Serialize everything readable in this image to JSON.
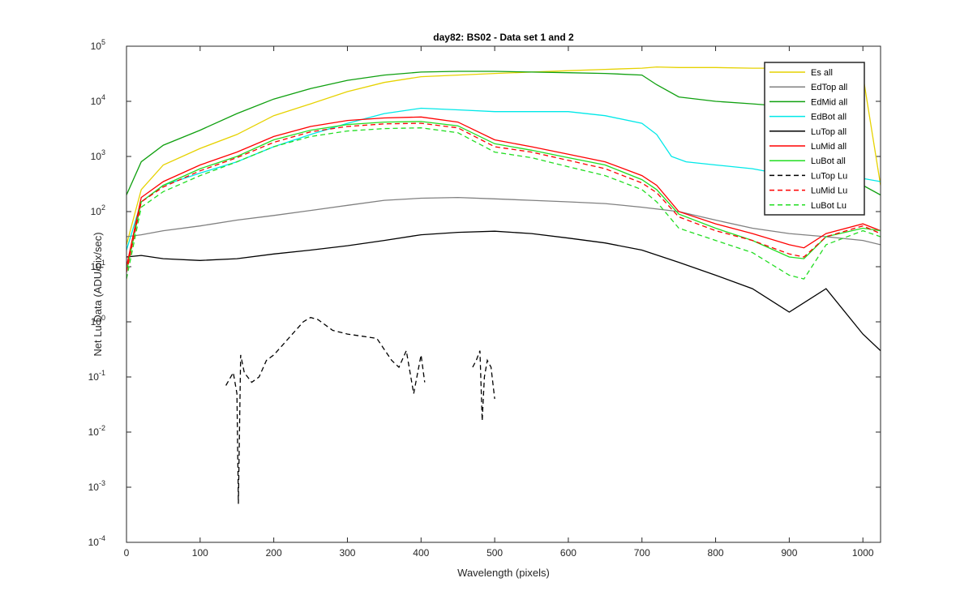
{
  "chart_data": {
    "type": "line",
    "title": "day82: BS02 - Data set 1 and 2",
    "xlabel": "Wavelength (pixels)",
    "ylabel": "Net Lu Data (ADU/pix/sec)",
    "xlim": [
      0,
      1024
    ],
    "ylim": [
      0.0001,
      100000
    ],
    "yscale": "log",
    "grid": false,
    "legend_position": "top-right",
    "x_ticks": [
      "0",
      "100",
      "200",
      "300",
      "400",
      "500",
      "600",
      "700",
      "800",
      "900",
      "1000"
    ],
    "y_ticks": [
      {
        "base": "10",
        "exp": "-4"
      },
      {
        "base": "10",
        "exp": "-3"
      },
      {
        "base": "10",
        "exp": "-2"
      },
      {
        "base": "10",
        "exp": "-1"
      },
      {
        "base": "10",
        "exp": "0"
      },
      {
        "base": "10",
        "exp": "1"
      },
      {
        "base": "10",
        "exp": "2"
      },
      {
        "base": "10",
        "exp": "3"
      },
      {
        "base": "10",
        "exp": "4"
      },
      {
        "base": "10",
        "exp": "5"
      }
    ],
    "series": [
      {
        "name": "Es  all",
        "color": "#e6d200",
        "dash": "solid",
        "x": [
          0,
          20,
          50,
          100,
          150,
          200,
          250,
          300,
          350,
          400,
          450,
          500,
          550,
          600,
          650,
          700,
          720,
          750,
          800,
          850,
          900,
          950,
          1000,
          1024
        ],
        "y": [
          25,
          250,
          700,
          1400,
          2500,
          5500,
          9000,
          15000,
          22000,
          28000,
          30000,
          32000,
          34000,
          36000,
          38000,
          40000,
          42000,
          41000,
          41000,
          40000,
          40000,
          39000,
          30000,
          300
        ]
      },
      {
        "name": "EdTop  all",
        "color": "#808080",
        "dash": "solid",
        "x": [
          0,
          20,
          50,
          100,
          150,
          200,
          250,
          300,
          350,
          400,
          450,
          500,
          550,
          600,
          650,
          700,
          750,
          800,
          850,
          900,
          950,
          1000,
          1024
        ],
        "y": [
          35,
          38,
          45,
          55,
          70,
          85,
          105,
          130,
          160,
          175,
          180,
          170,
          160,
          150,
          140,
          120,
          100,
          70,
          50,
          40,
          35,
          30,
          25
        ]
      },
      {
        "name": "EdMid  all",
        "color": "#0fa00f",
        "dash": "solid",
        "x": [
          0,
          20,
          50,
          100,
          150,
          200,
          250,
          300,
          350,
          400,
          450,
          500,
          550,
          600,
          650,
          700,
          720,
          750,
          800,
          850,
          900,
          950,
          1000,
          1024
        ],
        "y": [
          200,
          800,
          1600,
          3000,
          6000,
          11000,
          17000,
          24000,
          30000,
          34000,
          35000,
          35000,
          34000,
          33000,
          32000,
          30000,
          20000,
          12000,
          10000,
          9000,
          8000,
          7500,
          300,
          200
        ]
      },
      {
        "name": "EdBot  all",
        "color": "#00e8e8",
        "dash": "solid",
        "x": [
          0,
          20,
          50,
          100,
          150,
          200,
          250,
          300,
          350,
          400,
          450,
          500,
          550,
          600,
          650,
          700,
          720,
          740,
          760,
          800,
          850,
          900,
          950,
          1000,
          1024
        ],
        "y": [
          20,
          150,
          300,
          500,
          800,
          1500,
          2500,
          4000,
          6000,
          7500,
          7000,
          6500,
          6500,
          6500,
          5500,
          4000,
          2500,
          1000,
          800,
          700,
          600,
          450,
          400,
          400,
          350
        ]
      },
      {
        "name": "LuTop  all",
        "color": "#000000",
        "dash": "solid",
        "x": [
          0,
          20,
          50,
          100,
          150,
          200,
          250,
          300,
          350,
          400,
          450,
          500,
          550,
          600,
          650,
          700,
          750,
          800,
          850,
          900,
          950,
          1000,
          1024
        ],
        "y": [
          15,
          16,
          14,
          13,
          14,
          17,
          20,
          24,
          30,
          38,
          42,
          44,
          40,
          33,
          27,
          20,
          12,
          7,
          4,
          1.5,
          4,
          0.6,
          0.3
        ]
      },
      {
        "name": "LuMid  all",
        "color": "#ff0000",
        "dash": "solid",
        "x": [
          0,
          20,
          50,
          100,
          150,
          200,
          250,
          300,
          350,
          400,
          450,
          500,
          550,
          600,
          650,
          700,
          720,
          750,
          800,
          850,
          900,
          920,
          950,
          1000,
          1024
        ],
        "y": [
          10,
          180,
          350,
          700,
          1200,
          2300,
          3500,
          4500,
          5000,
          5200,
          4200,
          2000,
          1500,
          1100,
          800,
          450,
          300,
          100,
          60,
          40,
          25,
          22,
          40,
          60,
          45
        ]
      },
      {
        "name": "LuBot  all",
        "color": "#22dd22",
        "dash": "solid",
        "x": [
          0,
          20,
          50,
          100,
          150,
          200,
          250,
          300,
          350,
          400,
          450,
          500,
          550,
          600,
          650,
          700,
          720,
          750,
          800,
          850,
          900,
          920,
          950,
          1000,
          1024
        ],
        "y": [
          8,
          150,
          300,
          600,
          1000,
          2000,
          3000,
          3800,
          4200,
          4300,
          3600,
          1700,
          1300,
          950,
          700,
          380,
          250,
          90,
          50,
          30,
          15,
          14,
          35,
          50,
          45
        ]
      },
      {
        "name": "LuTop  Lu",
        "color": "#000000",
        "dash": "dashed",
        "x": [
          135,
          145,
          150,
          152,
          155,
          160,
          170,
          180,
          190,
          200,
          220,
          240,
          250,
          260,
          280,
          300,
          320,
          340,
          360,
          370,
          380,
          390,
          400,
          405
        ],
        "y": [
          0.07,
          0.12,
          0.05,
          0.0005,
          0.25,
          0.12,
          0.08,
          0.1,
          0.2,
          0.25,
          0.5,
          1.0,
          1.2,
          1.1,
          0.7,
          0.6,
          0.55,
          0.5,
          0.2,
          0.15,
          0.3,
          0.05,
          0.25,
          0.08
        ]
      },
      {
        "name": "LuMid  Lu",
        "color": "#ff0000",
        "dash": "dashed",
        "x": [
          0,
          20,
          50,
          100,
          150,
          200,
          250,
          300,
          350,
          400,
          450,
          500,
          550,
          600,
          650,
          700,
          720,
          750,
          800,
          850,
          900,
          920,
          950,
          1000,
          1024
        ],
        "y": [
          8,
          150,
          280,
          550,
          950,
          1800,
          2800,
          3500,
          3900,
          4000,
          3300,
          1500,
          1200,
          850,
          600,
          330,
          220,
          80,
          45,
          30,
          17,
          15,
          35,
          55,
          40
        ]
      },
      {
        "name": "LuBot  Lu",
        "color": "#22dd22",
        "dash": "dashed",
        "x": [
          0,
          20,
          50,
          100,
          150,
          200,
          250,
          300,
          350,
          400,
          450,
          500,
          550,
          600,
          650,
          700,
          720,
          750,
          800,
          850,
          900,
          920,
          950,
          1000,
          1024
        ],
        "y": [
          6,
          120,
          230,
          450,
          800,
          1500,
          2300,
          2900,
          3200,
          3300,
          2700,
          1200,
          950,
          650,
          450,
          250,
          150,
          50,
          30,
          18,
          7,
          6,
          25,
          45,
          35
        ]
      }
    ],
    "extra_segments": [
      {
        "series": "LuTop  Lu",
        "x": [
          470,
          475,
          480,
          483,
          486,
          490,
          495,
          500
        ],
        "y": [
          0.15,
          0.2,
          0.3,
          0.016,
          0.1,
          0.2,
          0.15,
          0.04
        ]
      }
    ]
  }
}
